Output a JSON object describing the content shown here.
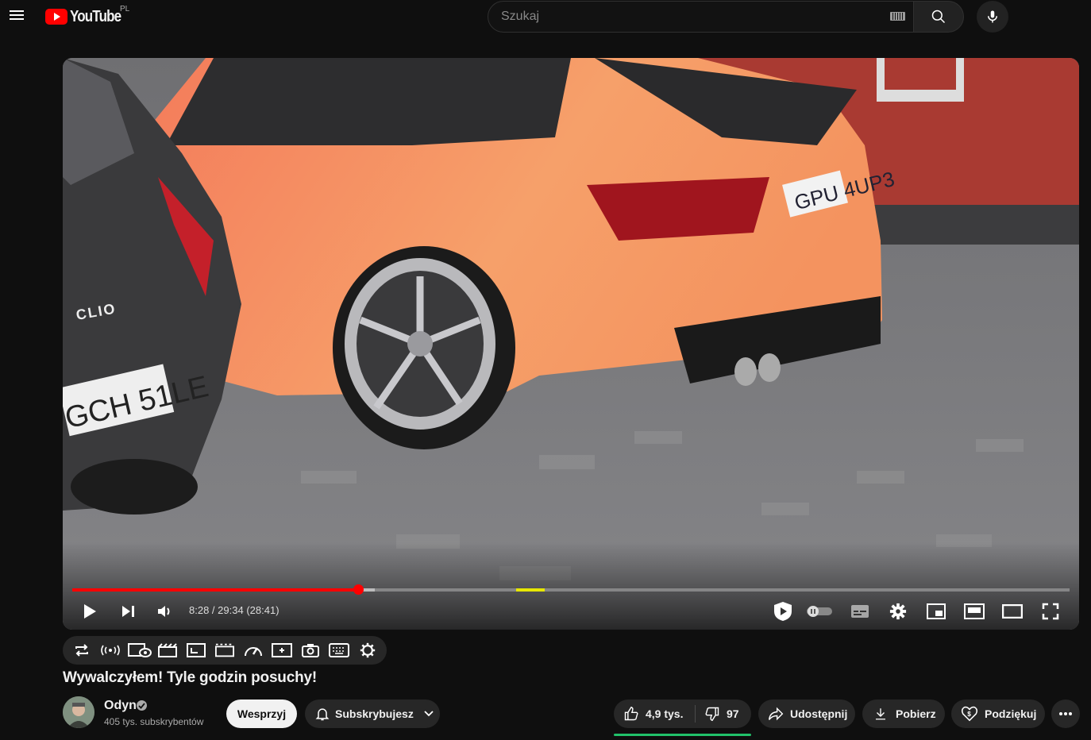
{
  "header": {
    "logo_text": "YouTube",
    "country_code": "PL",
    "search_placeholder": "Szukaj"
  },
  "player": {
    "current_time": "8:28",
    "separator": " / ",
    "total_time": "29:34",
    "skipped_duration": "(28:41)",
    "progress_played_fraction": 0.287,
    "progress_buffered_fraction": 0.303,
    "highlight_marker_fraction": [
      0.445,
      0.474
    ]
  },
  "video_scene": {
    "car_plate": "GPU 4UP3",
    "other_plate": "GCH 51LE",
    "model_badge": "CLIO",
    "colors": {
      "body": "#f28a5c",
      "road": "#77777a",
      "building": "#a93a32",
      "other_car": "#3a3a3c"
    }
  },
  "extension_toolbar": {
    "icons": [
      "loop-icon",
      "audio-mode-icon",
      "playback-view-icon",
      "cinema-icon",
      "frame-icon",
      "mini-player-icon",
      "speed-icon",
      "enhance-icon",
      "screenshot-icon",
      "keyboard-icon",
      "settings-gear-icon"
    ]
  },
  "video": {
    "title": "Wywalczyłem! Tyle godzin posuchy!"
  },
  "channel": {
    "name": "Odyn",
    "subscribers": "405 tys. subskrybentów"
  },
  "actions": {
    "support_label": "Wesprzyj",
    "subscribe_label": "Subskrybujesz",
    "likes": "4,9 tys.",
    "dislikes": "97",
    "share_label": "Udostępnij",
    "download_label": "Pobierz",
    "thanks_label": "Podziękuj"
  },
  "colors": {
    "accent_red": "#ff0000",
    "like_bar": "#21c26a",
    "background": "#0f0f0f"
  }
}
